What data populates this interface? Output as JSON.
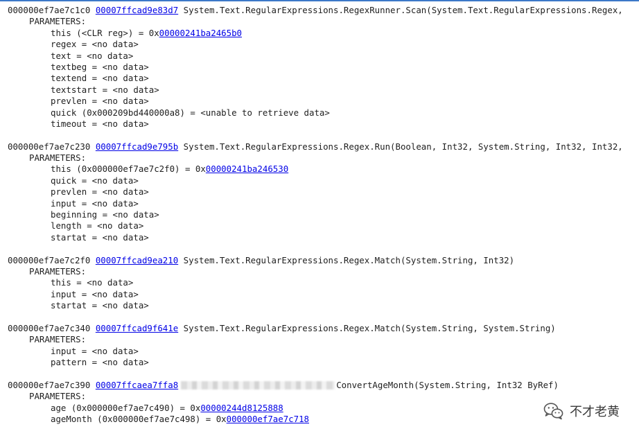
{
  "frames": [
    {
      "addr": "000000ef7ae7c1c0",
      "ip": "00007ffcad9e83d7",
      "method": "System.Text.RegularExpressions.RegexRunner.Scan(System.Text.RegularExpressions.Regex,",
      "params_header": "PARAMETERS:",
      "params": [
        {
          "prefix": "this (<CLR reg>) = 0x",
          "link": "00000241ba2465b0"
        },
        {
          "prefix": "regex = <no data>"
        },
        {
          "prefix": "text = <no data>"
        },
        {
          "prefix": "textbeg = <no data>"
        },
        {
          "prefix": "textend = <no data>"
        },
        {
          "prefix": "textstart = <no data>"
        },
        {
          "prefix": "prevlen = <no data>"
        },
        {
          "prefix": "quick (0x000209bd440000a8) = <unable to retrieve data>"
        },
        {
          "prefix": "timeout = <no data>"
        }
      ]
    },
    {
      "addr": "000000ef7ae7c230",
      "ip": "00007ffcad9e795b",
      "method": "System.Text.RegularExpressions.Regex.Run(Boolean, Int32, System.String, Int32, Int32,",
      "params_header": "PARAMETERS:",
      "params": [
        {
          "prefix": "this (0x000000ef7ae7c2f0) = 0x",
          "link": "00000241ba246530"
        },
        {
          "prefix": "quick = <no data>"
        },
        {
          "prefix": "prevlen = <no data>"
        },
        {
          "prefix": "input = <no data>"
        },
        {
          "prefix": "beginning = <no data>"
        },
        {
          "prefix": "length = <no data>"
        },
        {
          "prefix": "startat = <no data>"
        }
      ]
    },
    {
      "addr": "000000ef7ae7c2f0",
      "ip": "00007ffcad9ea210",
      "method": "System.Text.RegularExpressions.Regex.Match(System.String, Int32)",
      "params_header": "PARAMETERS:",
      "params": [
        {
          "prefix": "this = <no data>"
        },
        {
          "prefix": "input = <no data>"
        },
        {
          "prefix": "startat = <no data>"
        }
      ]
    },
    {
      "addr": "000000ef7ae7c340",
      "ip": "00007ffcad9f641e",
      "method": "System.Text.RegularExpressions.Regex.Match(System.String, System.String)",
      "params_header": "PARAMETERS:",
      "params": [
        {
          "prefix": "input = <no data>"
        },
        {
          "prefix": "pattern = <no data>"
        }
      ]
    },
    {
      "addr": "000000ef7ae7c390",
      "ip": "00007ffcaea7ffa8",
      "redacted": true,
      "method": "ConvertAgeMonth(System.String, Int32 ByRef)",
      "params_header": "PARAMETERS:",
      "params": [
        {
          "prefix": "age (0x000000ef7ae7c490) = 0x",
          "link": "00000244d8125888"
        },
        {
          "prefix": "ageMonth (0x000000ef7ae7c498) = 0x",
          "link": "000000ef7ae7c718"
        }
      ]
    }
  ],
  "watermark": {
    "icon": "wechat-icon",
    "text": "不才老黄"
  },
  "colors": {
    "link": "#0000e6",
    "text": "#1e1e1e",
    "border": "#3c78c8"
  }
}
